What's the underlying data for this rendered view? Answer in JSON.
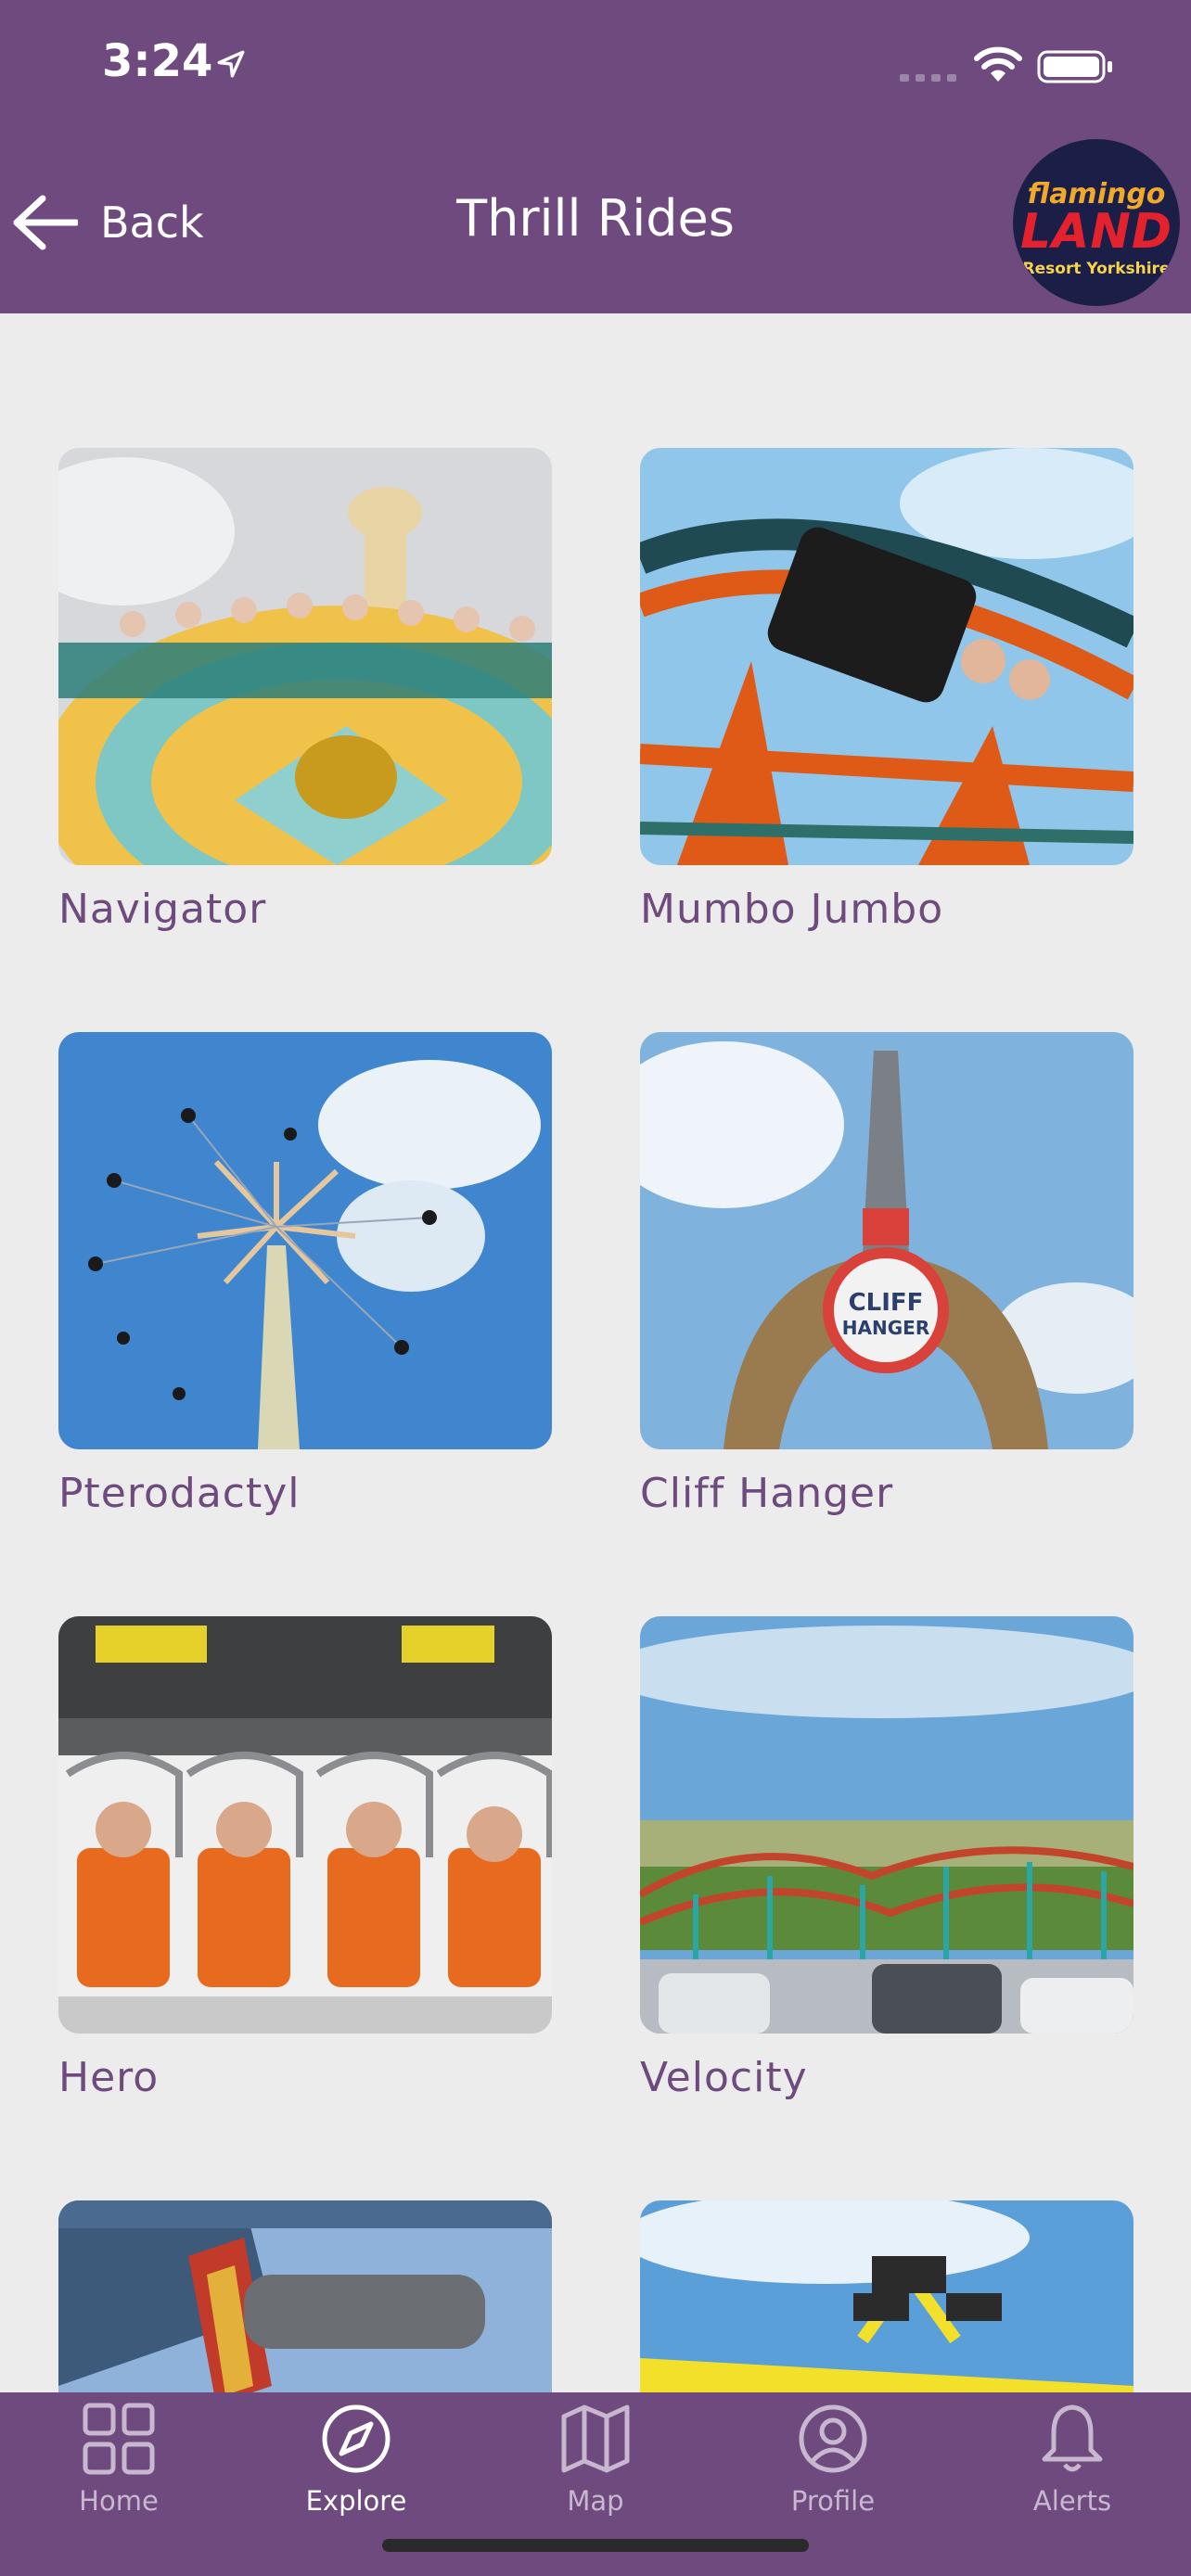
{
  "status_bar": {
    "time": "3:24"
  },
  "nav": {
    "back_label": "Back",
    "title": "Thrill Rides"
  },
  "logo": {
    "line1": "flamingo",
    "line2": "LAND",
    "line3": "Resort Yorkshire"
  },
  "rides": [
    {
      "label": "Navigator"
    },
    {
      "label": "Mumbo Jumbo"
    },
    {
      "label": "Pterodactyl"
    },
    {
      "label": "Cliff Hanger"
    },
    {
      "label": "Hero"
    },
    {
      "label": "Velocity"
    },
    {
      "label": ""
    },
    {
      "label": ""
    }
  ],
  "tabs": [
    {
      "label": "Home",
      "icon": "grid-icon"
    },
    {
      "label": "Explore",
      "icon": "compass-icon",
      "active": true
    },
    {
      "label": "Map",
      "icon": "map-icon"
    },
    {
      "label": "Profile",
      "icon": "profile-icon"
    },
    {
      "label": "Alerts",
      "icon": "bell-icon"
    }
  ],
  "colors": {
    "brand": "#6e4a7e",
    "background": "#ececec",
    "tab_inactive": "#c8b8cf"
  }
}
